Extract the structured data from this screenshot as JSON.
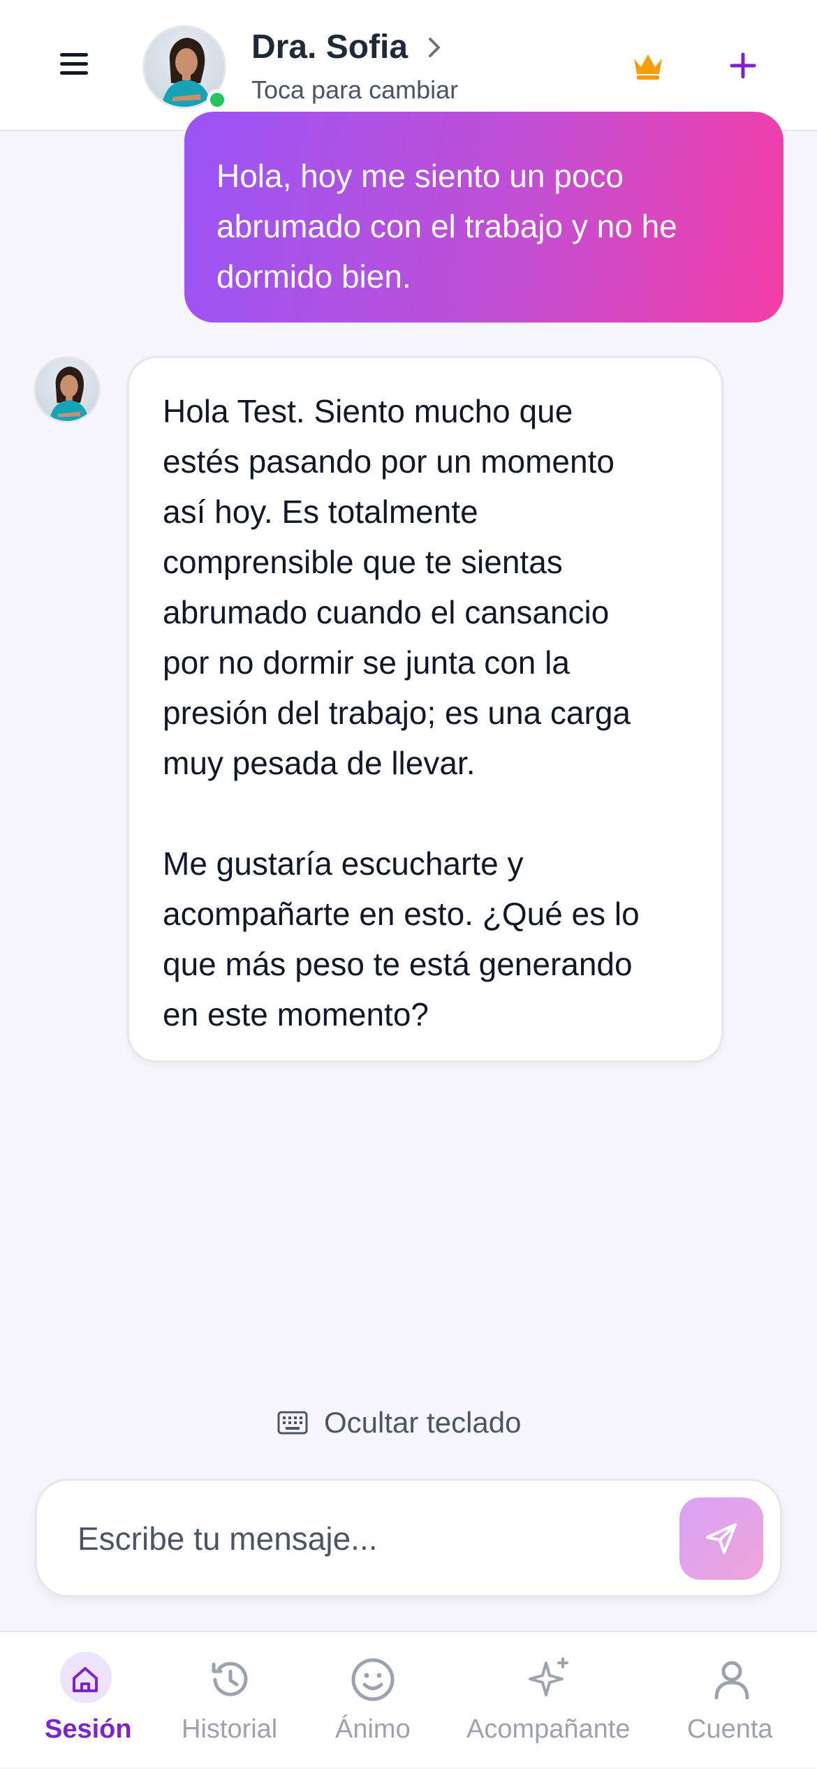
{
  "header": {
    "name": "Dra. Sofia",
    "subtitle": "Toca para cambiar",
    "status": "online",
    "icons": {
      "menu": "menu-icon",
      "chevron": "chevron-right-icon",
      "crown": "crown-icon",
      "plus": "plus-icon"
    },
    "colors": {
      "crown": "#f59e0b",
      "plus": "#7e22ce",
      "online": "#22c55e"
    }
  },
  "messages": [
    {
      "role": "user",
      "lines": [
        "Hola, hoy me siento un poco",
        "abrumado con el trabajo y no he",
        "dormido bien."
      ]
    },
    {
      "role": "assistant",
      "paragraphs": [
        [
          "Hola Test. Siento mucho que",
          "estés pasando por un momento",
          "así hoy. Es totalmente",
          "comprensible que te sientas",
          "abrumado cuando el cansancio",
          "por no dormir se junta con la",
          "presión del trabajo; es una carga",
          "muy pesada de llevar."
        ],
        [
          "Me gustaría escucharte y",
          "acompañarte en esto. ¿Qué es lo",
          "que más peso te está generando",
          "en este momento?"
        ]
      ]
    }
  ],
  "keyboard_toggle": {
    "label": "Ocultar teclado",
    "icon": "keyboard-icon"
  },
  "composer": {
    "placeholder": "Escribe tu mensaje...",
    "send_icon": "send-icon",
    "send_gradient": [
      "#d7a2f7",
      "#efa5d8"
    ]
  },
  "nav": [
    {
      "label": "Sesión",
      "icon": "home-icon",
      "active": true
    },
    {
      "label": "Historial",
      "icon": "history-icon",
      "active": false
    },
    {
      "label": "Ánimo",
      "icon": "smile-icon",
      "active": false
    },
    {
      "label": "Acompañante",
      "icon": "sparkles-icon",
      "active": false
    },
    {
      "label": "Cuenta",
      "icon": "user-icon",
      "active": false
    }
  ],
  "colors": {
    "accent": "#7e22ce",
    "user_bubble_gradient": [
      "#9a55f6",
      "#f43ea6"
    ],
    "background": "#f7f6fc"
  }
}
